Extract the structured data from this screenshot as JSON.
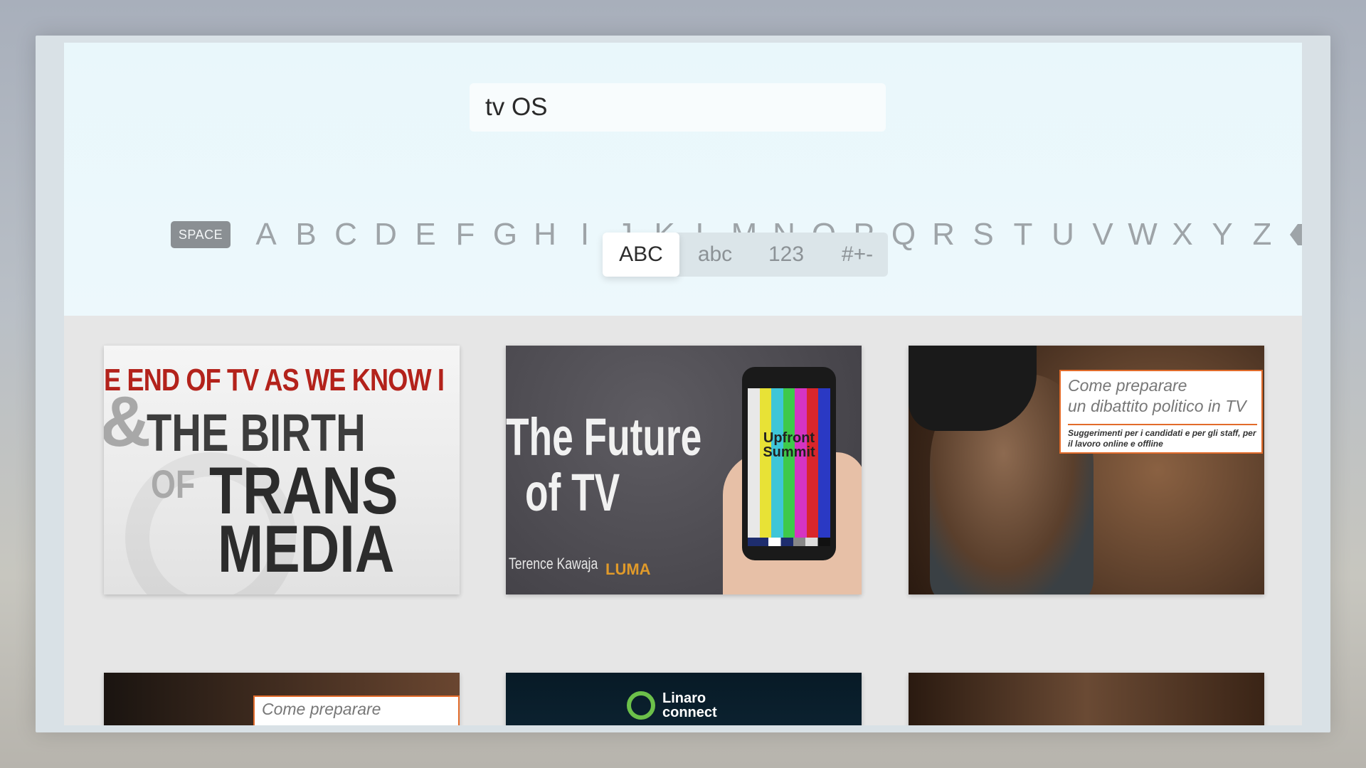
{
  "search": {
    "query": "tv OS"
  },
  "keyboard": {
    "space_label": "SPACE",
    "letters": [
      "A",
      "B",
      "C",
      "D",
      "E",
      "F",
      "G",
      "H",
      "I",
      "J",
      "K",
      "L",
      "M",
      "N",
      "O",
      "P",
      "Q",
      "R",
      "S",
      "T",
      "U",
      "V",
      "W",
      "X",
      "Y",
      "Z"
    ],
    "delete_icon": "delete-backspace-icon"
  },
  "modes": [
    "ABC",
    "abc",
    "123",
    "#+-"
  ],
  "active_mode": "ABC",
  "results": [
    {
      "lines": [
        "E END OF TV AS WE KNOW I",
        "&",
        "THE BIRTH",
        "OF",
        "TRANS",
        "MEDIA"
      ]
    },
    {
      "title_lines": [
        "The Future",
        "of TV"
      ],
      "author": "Terence Kawaja",
      "brand": "LUMA",
      "phone_text": "Upfront Summit"
    },
    {
      "title_lines": [
        "Come preparare",
        "un dibattito politico in TV"
      ],
      "subtitle": "Suggerimenti per i candidati e per gli staff, per il lavoro online e offline"
    },
    {
      "title_lines": [
        "Come preparare"
      ]
    },
    {
      "brand_lines": [
        "Linaro",
        "connect"
      ]
    },
    {}
  ],
  "colors": {
    "accent_red": "#b3221b",
    "accent_orange": "#e26b2a",
    "keyboard_bg": "#e9f7fb"
  }
}
